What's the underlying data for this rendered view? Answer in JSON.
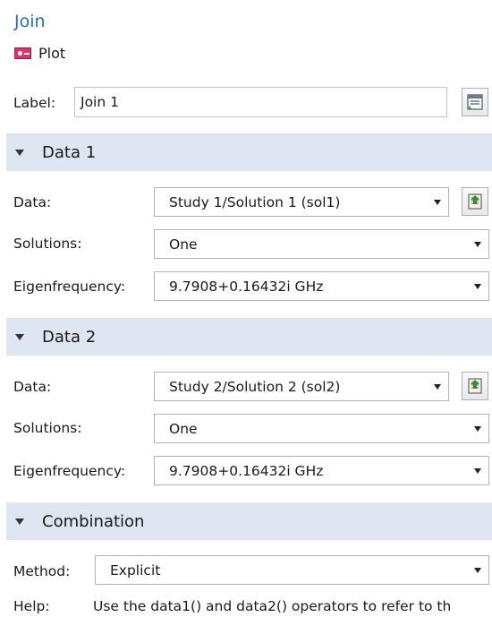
{
  "header": {
    "title": "Join",
    "node_type": "Plot"
  },
  "label_field": {
    "label": "Label:",
    "value": "Join 1"
  },
  "data1": {
    "section_title": "Data 1",
    "data_label": "Data:",
    "data_value": "Study 1/Solution 1 (sol1)",
    "solutions_label": "Solutions:",
    "solutions_value": "One",
    "eigen_label": "Eigenfrequency:",
    "eigen_value": "9.7908+0.16432i GHz"
  },
  "data2": {
    "section_title": "Data 2",
    "data_label": "Data:",
    "data_value": "Study 2/Solution 2 (sol2)",
    "solutions_label": "Solutions:",
    "solutions_value": "One",
    "eigen_label": "Eigenfrequency:",
    "eigen_value": "9.7908+0.16432i GHz"
  },
  "combination": {
    "section_title": "Combination",
    "method_label": "Method:",
    "method_value": "Explicit",
    "help_label": "Help:",
    "help_text": "Use the data1() and data2() operators to refer to th"
  }
}
